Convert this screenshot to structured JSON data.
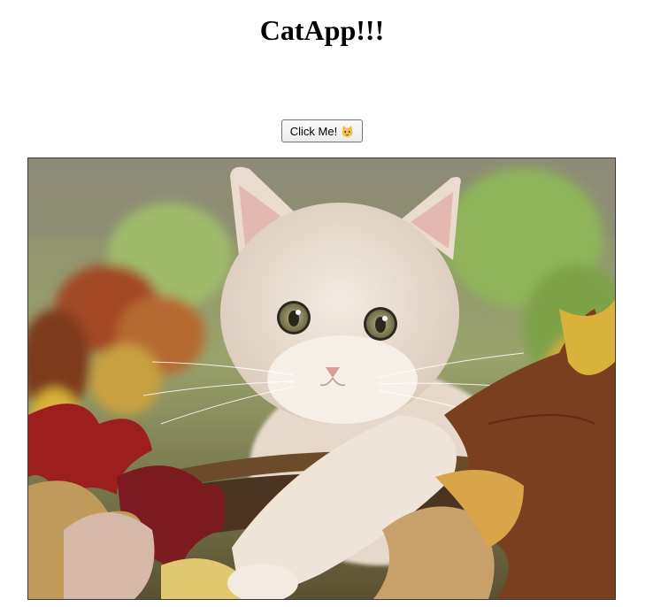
{
  "page": {
    "title": "CatApp!!!"
  },
  "button": {
    "label": "Click Me!",
    "icon": "cat-face-icon"
  },
  "image": {
    "subject": "cat-photo",
    "colors": {
      "background_top": "#8c8a70",
      "greenery": "#8fae5c",
      "fur": "#eadfd2",
      "eyes": "#8a8a5a",
      "leaf_red": "#9c1f1e",
      "leaf_brown": "#7a3f1f",
      "leaf_tan": "#c8a06a",
      "leaf_yellow": "#d8b23a"
    }
  }
}
